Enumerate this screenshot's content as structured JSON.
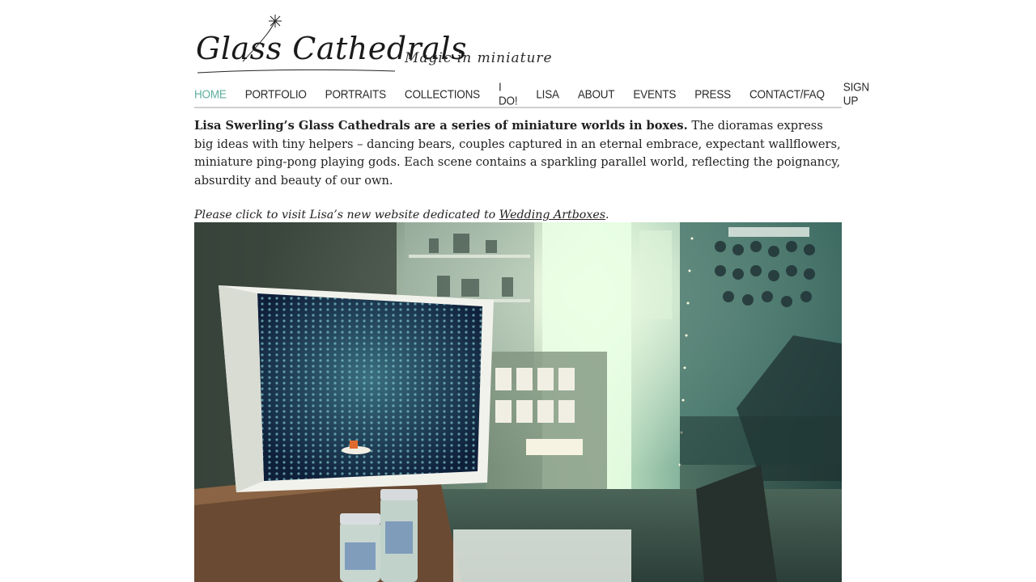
{
  "site": {
    "title": "Glass Cathedrals",
    "tagline": "Magic in miniature"
  },
  "nav": {
    "items": [
      {
        "label": "HOME",
        "active": true
      },
      {
        "label": "PORTFOLIO"
      },
      {
        "label": "PORTRAITS"
      },
      {
        "label": "COLLECTIONS"
      },
      {
        "label": "I DO!"
      },
      {
        "label": "LISA"
      },
      {
        "label": "ABOUT"
      },
      {
        "label": "EVENTS"
      },
      {
        "label": "PRESS"
      },
      {
        "label": "CONTACT/FAQ"
      },
      {
        "label": "SIGN UP"
      }
    ]
  },
  "intro": {
    "lead": "Lisa Swerling’s Glass Cathedrals are a series of miniature worlds in boxes.",
    "body": " The dioramas express big ideas with tiny helpers – dancing bears, couples captured in an eternal embrace, expectant wallflowers, miniature ping-pong playing gods. Each scene contains a sparkling parallel world, reflecting the poignancy, absurdity and beauty of our own."
  },
  "notice": {
    "prefix": "Please click to visit Lisa’s new website dedicated to ",
    "link_text": "Wedding Artboxes",
    "suffix": "."
  },
  "colors": {
    "nav_active": "#5fae9e",
    "divider": "#cfcfcf"
  }
}
